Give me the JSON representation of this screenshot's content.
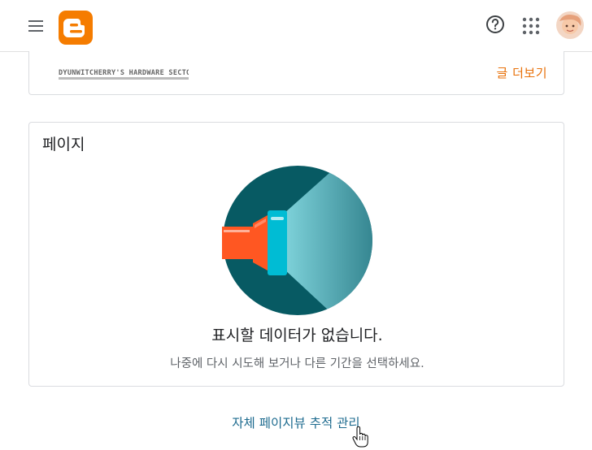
{
  "header": {
    "menu_icon": "menu-icon",
    "logo_icon": "blogger-logo",
    "help_icon": "help-icon",
    "apps_icon": "apps-grid-icon",
    "avatar": "user-avatar",
    "brand_color": "#f57c00"
  },
  "posts_card": {
    "banner_text": "DYUNWITCHERRY'S HARDWARE SECTOR",
    "more_label": "글 더보기"
  },
  "pages_card": {
    "title": "페이지",
    "empty_title": "표시할 데이터가 없습니다.",
    "empty_subtitle": "나중에 다시 시도해 보거나 다른 기간을 선택하세요.",
    "illustration": "flashlight-icon"
  },
  "footer": {
    "manage_label": "자체 페이지뷰 추적 관리",
    "cursor": "hand-cursor-icon"
  },
  "colors": {
    "accent_orange": "#e8710a",
    "link_teal": "#1e6b8f",
    "illus_dark": "#075a63"
  }
}
